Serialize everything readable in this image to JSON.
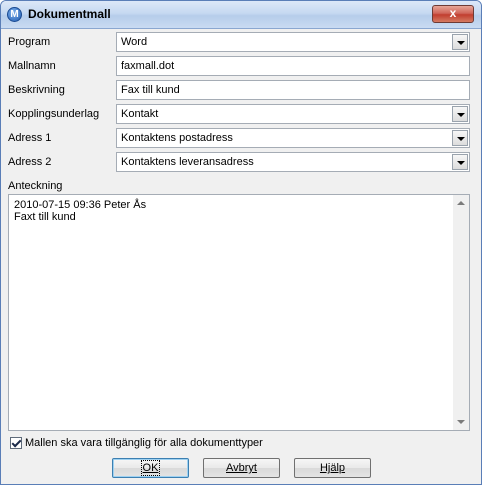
{
  "window": {
    "title": "Dokumentmall",
    "icon": "m-logo-icon",
    "close_label": "x"
  },
  "form": {
    "program": {
      "label": "Program",
      "value": "Word"
    },
    "mallnamn": {
      "label": "Mallnamn",
      "value": "faxmall.dot"
    },
    "beskrivning": {
      "label": "Beskrivning",
      "value": "Fax till kund"
    },
    "kopplingsunderlag": {
      "label": "Kopplingsunderlag",
      "value": "Kontakt"
    },
    "adress1": {
      "label": "Adress 1",
      "value": "Kontaktens postadress"
    },
    "adress2": {
      "label": "Adress 2",
      "value": "Kontaktens leveransadress"
    }
  },
  "notes": {
    "label": "Anteckning",
    "text": "2010-07-15 09:36 Peter Ås\nFaxt till kund"
  },
  "checkbox": {
    "label": "Mallen ska vara tillgänglig för alla dokumenttyper",
    "checked": true
  },
  "buttons": {
    "ok": "OK",
    "cancel": "Avbryt",
    "help": "Hjälp"
  }
}
